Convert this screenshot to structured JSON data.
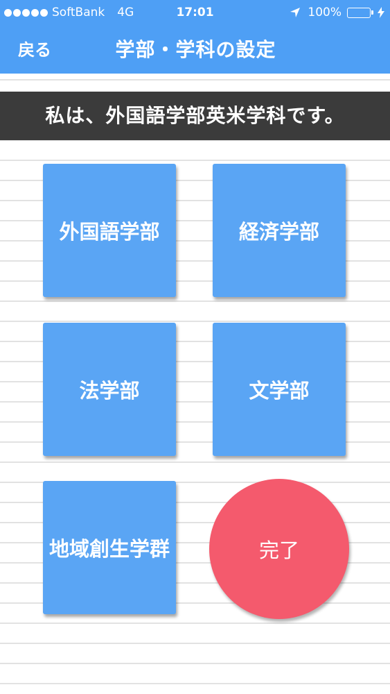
{
  "status_bar": {
    "carrier": "SoftBank",
    "network": "4G",
    "time": "17:01",
    "battery": "100%",
    "battery_level": 1.0,
    "icons": [
      "signal-dots-icon",
      "location-arrow-icon",
      "battery-icon",
      "charging-bolt-icon"
    ]
  },
  "nav": {
    "back_label": "戻る",
    "title": "学部・学科の設定"
  },
  "banner": {
    "text": "私は、外国語学部英米学科です。"
  },
  "faculties": [
    {
      "label": "外国語学部"
    },
    {
      "label": "経済学部"
    },
    {
      "label": "法学部"
    },
    {
      "label": "文学部"
    },
    {
      "label": "地域創生学群"
    }
  ],
  "done_label": "完了",
  "colors": {
    "header": "#4e9ff5",
    "tile": "#5aa5f4",
    "banner": "#3b3b3b",
    "done": "#f45a6d",
    "battery": "#4cd964"
  }
}
